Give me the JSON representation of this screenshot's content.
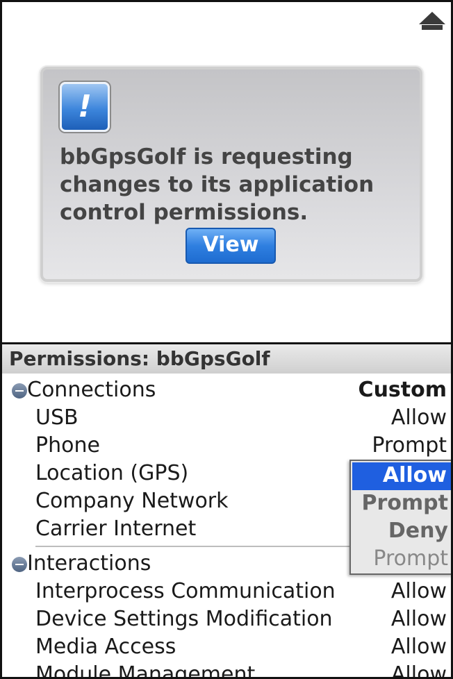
{
  "dialog": {
    "message": "bbGpsGolf is requesting changes to its application control permissions.",
    "view_label": "View"
  },
  "permissions": {
    "title": "Permissions: bbGpsGolf",
    "groups": [
      {
        "name": "Connections",
        "value": "Custom",
        "items": [
          {
            "label": "USB",
            "value": "Allow"
          },
          {
            "label": "Phone",
            "value": "Prompt"
          },
          {
            "label": "Location (GPS)",
            "value": ""
          },
          {
            "label": "Company Network",
            "value": ""
          },
          {
            "label": "Carrier Internet",
            "value": ""
          }
        ]
      },
      {
        "name": "Interactions",
        "value": "",
        "items": [
          {
            "label": "Interprocess Communication",
            "value": "Allow"
          },
          {
            "label": "Device Settings Modification",
            "value": "Allow"
          },
          {
            "label": "Media Access",
            "value": "Allow"
          },
          {
            "label": "Module Management",
            "value": "Allow"
          }
        ]
      }
    ]
  },
  "dropdown": {
    "options": [
      "Allow",
      "Prompt",
      "Deny"
    ],
    "selected": "Allow",
    "underlying_value": "Prompt"
  },
  "colors": {
    "selection_blue": "#1f5fe0",
    "button_blue": "#2f7fe0"
  },
  "icons": [
    "scroll-up-arrow-icon",
    "alert-exclamation-icon",
    "collapse-minus-icon"
  ]
}
